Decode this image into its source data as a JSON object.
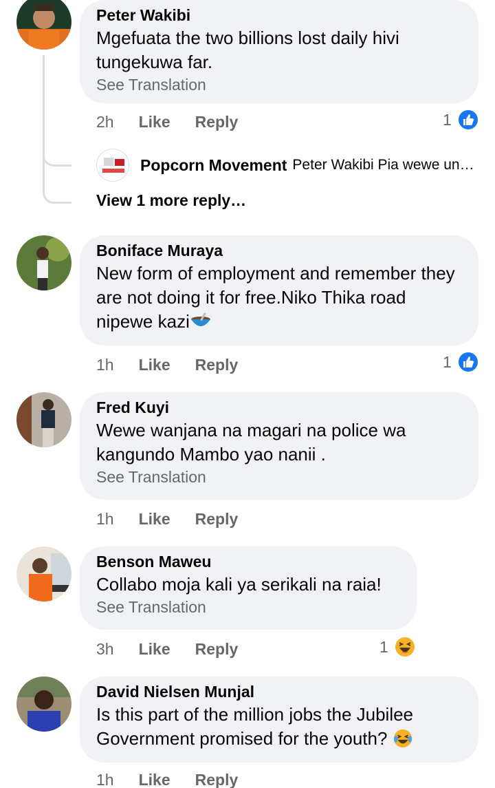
{
  "comments": [
    {
      "author": "Peter Wakibi",
      "text": "Mgefuata the two billions lost daily hivi tungekuwa far.",
      "see_translation": "See Translation",
      "time": "2h",
      "like": "Like",
      "reply": "Reply",
      "reaction_count": "1",
      "reaction_icon": "like-icon",
      "replies": {
        "author": "Popcorn Movement",
        "text": "Peter Wakibi Pia wewe un…",
        "view_more": "View 1 more reply…"
      }
    },
    {
      "author": "Boniface Muraya",
      "text": "New form of employment and remember they are not doing it for free.Niko Thika road nipewe kazi",
      "emoji": "bowl-emoji",
      "time": "1h",
      "like": "Like",
      "reply": "Reply",
      "reaction_count": "1",
      "reaction_icon": "like-icon"
    },
    {
      "author": "Fred Kuyi",
      "text": "Wewe wanjana na magari na police wa kangundo Mambo yao nanii .",
      "see_translation": "See Translation",
      "time": "1h",
      "like": "Like",
      "reply": "Reply"
    },
    {
      "author": "Benson Maweu",
      "text": "Collabo moja kali ya serikali na raia!",
      "see_translation": "See Translation",
      "time": "3h",
      "like": "Like",
      "reply": "Reply",
      "reaction_count": "1",
      "reaction_icon": "haha-icon"
    },
    {
      "author": "David Nielsen Munjal",
      "text": "Is this part of the million jobs the Jubilee Government promised for the youth?",
      "emoji": "laughing-tears-emoji",
      "time": "1h",
      "like": "Like",
      "reply": "Reply"
    }
  ],
  "colors": {
    "bubble": "#f0f2f5",
    "meta_text": "#65676b",
    "like_blue": "#1877f2",
    "haha_yellow": "#f7b125"
  }
}
